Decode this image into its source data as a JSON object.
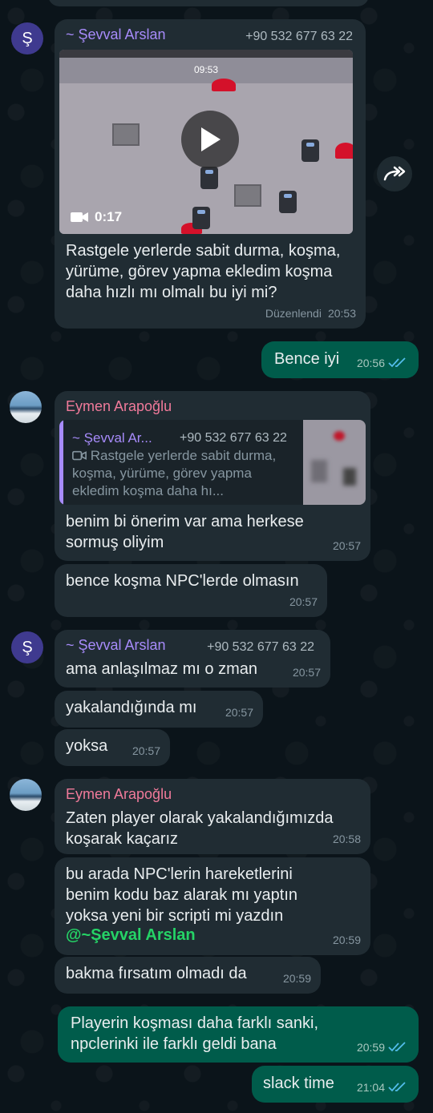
{
  "messages": {
    "m1": {
      "sender": "~ Şevval Arslan",
      "phone": "+90 532 677 63 22",
      "video_timestamp": "09:53",
      "video_duration": "0:17",
      "text": "Rastgele yerlerde sabit durma, koşma, yürüme, görev yapma ekledim koşma daha hızlı mı olmalı bu iyi mi?",
      "edited": "Düzenlendi",
      "time": "20:53"
    },
    "m2": {
      "text": "Bence iyi",
      "time": "20:56"
    },
    "m3": {
      "sender": "Eymen Arapoğlu",
      "quote_sender": "~ Şevval Ar...",
      "quote_phone": "+90 532 677 63 22",
      "quote_text": "Rastgele yerlerde sabit durma, koşma, yürüme, görev yapma ekledim koşma daha hı...",
      "text": "benim bi önerim var ama herkese sormuş oliyim",
      "time": "20:57"
    },
    "m4": {
      "text": "bence koşma NPC'lerde olmasın",
      "time": "20:57"
    },
    "m5": {
      "sender": "~ Şevval Arslan",
      "phone": "+90 532 677 63 22",
      "text": "ama anlaşılmaz mı o zman",
      "time": "20:57"
    },
    "m6": {
      "text": "yakalandığında mı",
      "time": "20:57"
    },
    "m7": {
      "text": "yoksa",
      "time": "20:57"
    },
    "m8": {
      "sender": "Eymen Arapoğlu",
      "text": "Zaten player olarak yakalandığımızda koşarak kaçarız",
      "time": "20:58"
    },
    "m9": {
      "text": "bu arada NPC'lerin hareketlerini benim kodu baz alarak mı yaptın yoksa yeni bir scripti mi yazdın",
      "mention": "@~Şevval Arslan",
      "time": "20:59"
    },
    "m10": {
      "text": "bakma fırsatım olmadı da",
      "time": "20:59"
    },
    "m11": {
      "text": "Playerin koşması daha farklı sanki, npclerinki ile farklı geldi bana",
      "time": "20:59"
    },
    "m12": {
      "text": "slack time",
      "time": "21:04"
    }
  },
  "avatars": {
    "sevval_initial": "Ş"
  },
  "colors": {
    "background": "#0b141a",
    "incoming": "#202c33",
    "outgoing": "#005c4b",
    "tick_read": "#53bdeb",
    "mention": "#25d366"
  }
}
